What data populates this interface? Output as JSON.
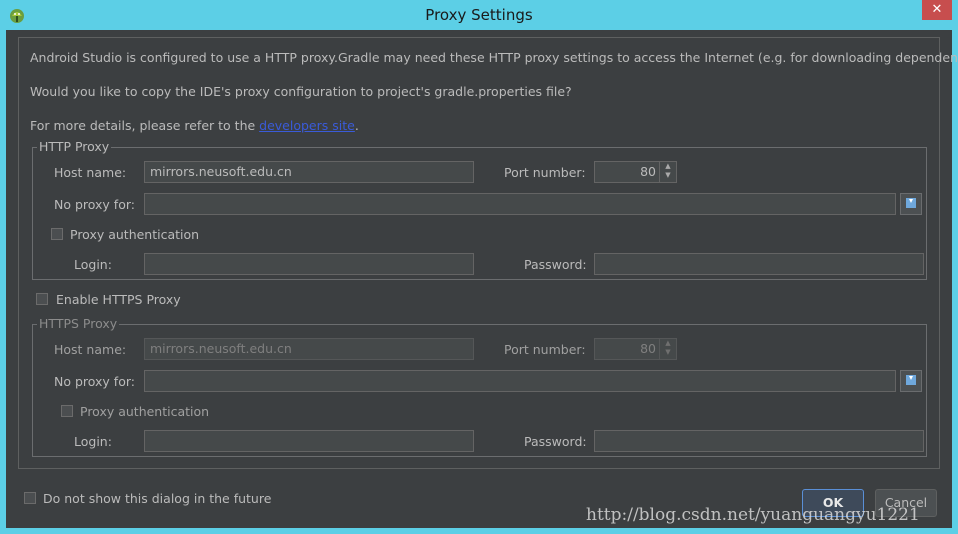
{
  "window": {
    "title": "Proxy Settings",
    "close_glyph": "✕"
  },
  "info": {
    "line1": "Android Studio is configured to use a HTTP proxy.Gradle may need these HTTP proxy settings to access the Internet (e.g. for downloading dependencies.)",
    "line2": "Would you like to copy the IDE's proxy configuration to project's gradle.properties file?",
    "line3_prefix": "For more details, please refer to the ",
    "line3_link": "developers site",
    "line3_suffix": "."
  },
  "http_proxy": {
    "group_title": "HTTP Proxy",
    "host_label": "Host name:",
    "host_value": "mirrors.neusoft.edu.cn",
    "port_label": "Port number:",
    "port_value": "80",
    "no_proxy_label": "No proxy for:",
    "no_proxy_value": "",
    "auth_label": "Proxy authentication",
    "auth_checked": false,
    "login_label": "Login:",
    "login_value": "",
    "password_label": "Password:",
    "password_value": ""
  },
  "enable_https": {
    "label": "Enable HTTPS Proxy",
    "checked": false
  },
  "https_proxy": {
    "group_title": "HTTPS Proxy",
    "host_label": "Host name:",
    "host_value": "mirrors.neusoft.edu.cn",
    "port_label": "Port number:",
    "port_value": "80",
    "no_proxy_label": "No proxy for:",
    "no_proxy_value": "",
    "auth_label": "Proxy authentication",
    "auth_checked": false,
    "login_label": "Login:",
    "login_value": "",
    "password_label": "Password:",
    "password_value": ""
  },
  "footer": {
    "dont_show_label": "Do not show this dialog in the future",
    "dont_show_checked": false,
    "ok_label": "OK",
    "cancel_label": "Cancel"
  },
  "watermark": "http://blog.csdn.net/yuanguangyu1221",
  "colors": {
    "title_bar": "#5ccfe6",
    "dialog_bg": "#3c3f41",
    "link": "#3a5bd9",
    "ok_border": "#5a8fd6"
  },
  "icons": {
    "app": "android-studio-icon",
    "browse": "browse-icon"
  }
}
